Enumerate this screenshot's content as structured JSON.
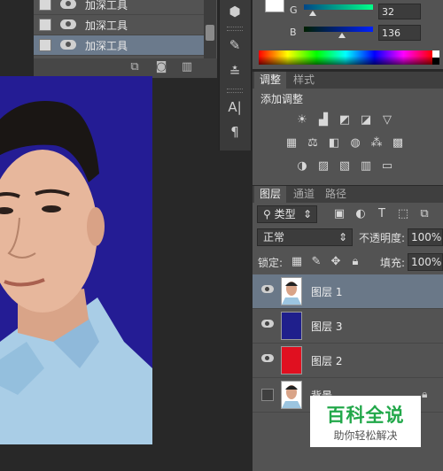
{
  "history": {
    "items": [
      {
        "label": "加深工具",
        "selected": false
      },
      {
        "label": "加深工具",
        "selected": false
      },
      {
        "label": "加深工具",
        "selected": true
      }
    ],
    "footer_icons": [
      "new-snapshot-icon",
      "camera-icon",
      "trash-icon"
    ]
  },
  "toolstrip": {
    "icons": [
      "3d-cube-icon",
      "brush-presets-icon",
      "brush-settings-icon",
      "character-icon",
      "paragraph-icon"
    ],
    "character_glyph": "A|",
    "paragraph_glyph": "¶"
  },
  "color": {
    "g_label": "G",
    "g_value": "32",
    "b_label": "B",
    "b_value": "136",
    "foreground": "#ffffff",
    "spectrum_colors": [
      "#ff0000",
      "#ffff00",
      "#00ff00",
      "#00ffff",
      "#0000ff",
      "#ff00ff"
    ]
  },
  "adjustments": {
    "tabs": [
      "调整",
      "样式"
    ],
    "heading": "添加调整"
  },
  "layers": {
    "tabs": [
      "图层",
      "通道",
      "路径"
    ],
    "filter_label": "类型",
    "blend_mode": "正常",
    "opacity_label": "不透明度:",
    "opacity_value": "100%",
    "lock_label": "锁定:",
    "fill_label": "填充:",
    "fill_value": "100%",
    "items": [
      {
        "name": "图层 1",
        "selected": true,
        "visible": true,
        "swatch": "photo"
      },
      {
        "name": "图层 3",
        "selected": false,
        "visible": true,
        "swatch": "#1f1f8c"
      },
      {
        "name": "图层 2",
        "selected": false,
        "visible": true,
        "swatch": "#e01020"
      },
      {
        "name": "背景",
        "selected": false,
        "visible": false,
        "swatch": "photo"
      }
    ]
  },
  "canvas": {
    "background_color": "#241c94"
  },
  "watermark": {
    "title": "百科全说",
    "subtitle": "助你轻松解决"
  }
}
